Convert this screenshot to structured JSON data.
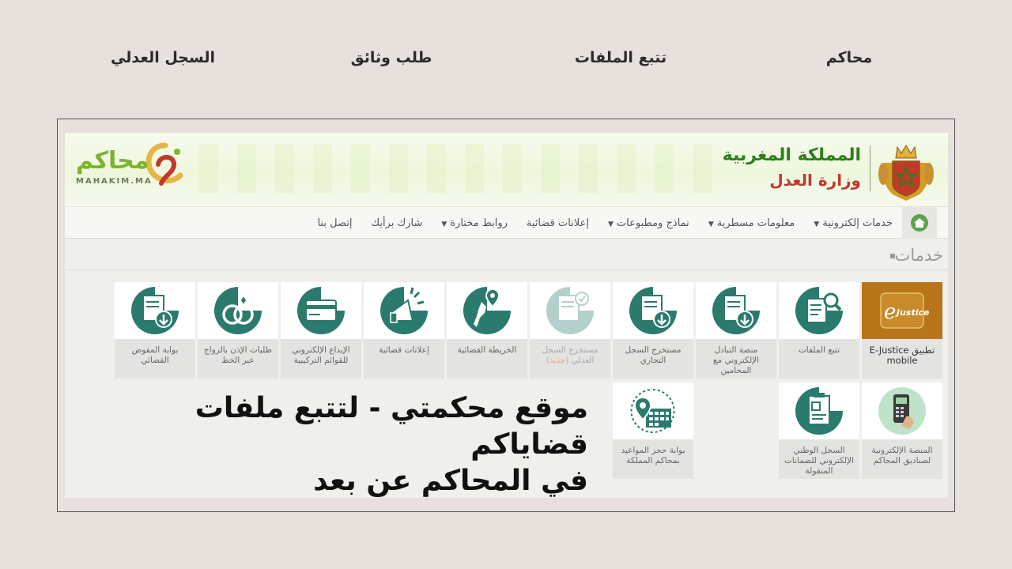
{
  "top_nav": [
    {
      "label": "محاكم",
      "id": "courts"
    },
    {
      "label": "تتبع الملفات",
      "id": "track-files"
    },
    {
      "label": "طلب وثائق",
      "id": "request-documents"
    },
    {
      "label": "السجل العدلي",
      "id": "judicial-record"
    }
  ],
  "header": {
    "kingdom": "المملكة المغربية",
    "ministry": "وزارة العدل",
    "logo_arabic": "محاكم",
    "logo_latin": "MAHAKIM.MA"
  },
  "menu": {
    "items": [
      "خدمات إلكترونية",
      "معلومات مسطرية",
      "نماذج ومطبوعات",
      "إعلانات قضائية",
      "روابط مختارة",
      "شارك برأيك",
      "إتصل بنا"
    ]
  },
  "section": {
    "title": "خدمات"
  },
  "tiles": [
    {
      "label": "تطبيق E-Justice mobile",
      "icon": "ejustice-app-icon"
    },
    {
      "label": "تتبع الملفات",
      "icon": "file-search-icon"
    },
    {
      "label": "منصة التبادل الإلكتروني مع المحامين",
      "icon": "document-download-icon"
    },
    {
      "label": "مستخرج السجل التجاري",
      "icon": "document-download-icon"
    },
    {
      "label": "مستخرج السجل العدلي",
      "tag": "(جديد)",
      "icon": "document-check-icon"
    },
    {
      "label": "الخريطة القضائية",
      "icon": "map-icon"
    },
    {
      "label": "إعلانات قضائية",
      "icon": "megaphone-icon"
    },
    {
      "label": "الإيداع الإلكتروني للقوائم التركيبية",
      "icon": "card-icon"
    },
    {
      "label": "طلبات الإذن بالزواج عبر الخط",
      "icon": "rings-icon"
    },
    {
      "label": "بوابة المفوض القضائي",
      "icon": "document-download-icon"
    },
    {
      "label": "المنصة الإلكترونية لصناديق المحاكم",
      "icon": "payment-terminal-icon"
    },
    {
      "label": "السجل الوطني الإلكتروني للضمانات المنقولة",
      "icon": "clipboard-icon"
    },
    {
      "label": "بوابة حجز المواعيد بمحاكم المملكة",
      "icon": "calendar-pin-icon"
    }
  ],
  "caption": {
    "line1": "موقع محكمتي - لتتبع ملفات قضاياكم",
    "line2": "في المحاكم عن بعد"
  },
  "colors": {
    "icon_teal": "#2a7a6e",
    "kingdom_green": "#2e7d1e",
    "ministry_red": "#c0392b"
  }
}
